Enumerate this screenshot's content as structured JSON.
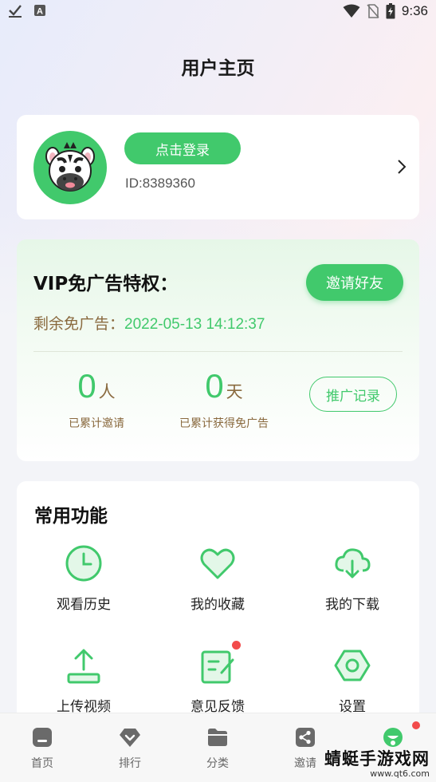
{
  "status_bar": {
    "time": "9:36",
    "icons": [
      "check-icon",
      "text-a-icon",
      "wifi-icon",
      "no-sim-icon",
      "battery-charging-icon"
    ]
  },
  "page": {
    "title": "用户主页"
  },
  "profile": {
    "login_button": "点击登录",
    "user_id": "ID:8389360",
    "avatar": "zebra-avatar"
  },
  "vip": {
    "title": "VIP免广告特权：",
    "invite_button": "邀请好友",
    "remaining_label": "剩余免广告：",
    "remaining_value": "2022-05-13 14:12:37",
    "invited_count": "0",
    "invited_unit": "人",
    "invited_label": "已累计邀请",
    "days_count": "0",
    "days_unit": "天",
    "days_label": "已累计获得免广告",
    "record_button": "推广记录"
  },
  "functions": {
    "title": "常用功能",
    "items": [
      {
        "label": "观看历史",
        "icon": "clock-icon"
      },
      {
        "label": "我的收藏",
        "icon": "heart-icon"
      },
      {
        "label": "我的下载",
        "icon": "cloud-download-icon"
      },
      {
        "label": "上传视频",
        "icon": "upload-icon"
      },
      {
        "label": "意见反馈",
        "icon": "edit-note-icon",
        "badge": true
      },
      {
        "label": "设置",
        "icon": "settings-hex-icon"
      }
    ]
  },
  "nav": {
    "items": [
      {
        "label": "首页",
        "icon": "home-icon"
      },
      {
        "label": "排行",
        "icon": "diamond-icon"
      },
      {
        "label": "分类",
        "icon": "folder-icon"
      },
      {
        "label": "邀请",
        "icon": "share-icon"
      },
      {
        "label": "",
        "icon": "profile-face-icon",
        "active": true,
        "badge": true
      }
    ]
  },
  "watermark": {
    "text": "蜻蜓手游戏网",
    "url": "www.qt6.com"
  },
  "colors": {
    "accent": "#41c96c",
    "brown": "#8a6a3f",
    "badge": "#f24b4b"
  }
}
